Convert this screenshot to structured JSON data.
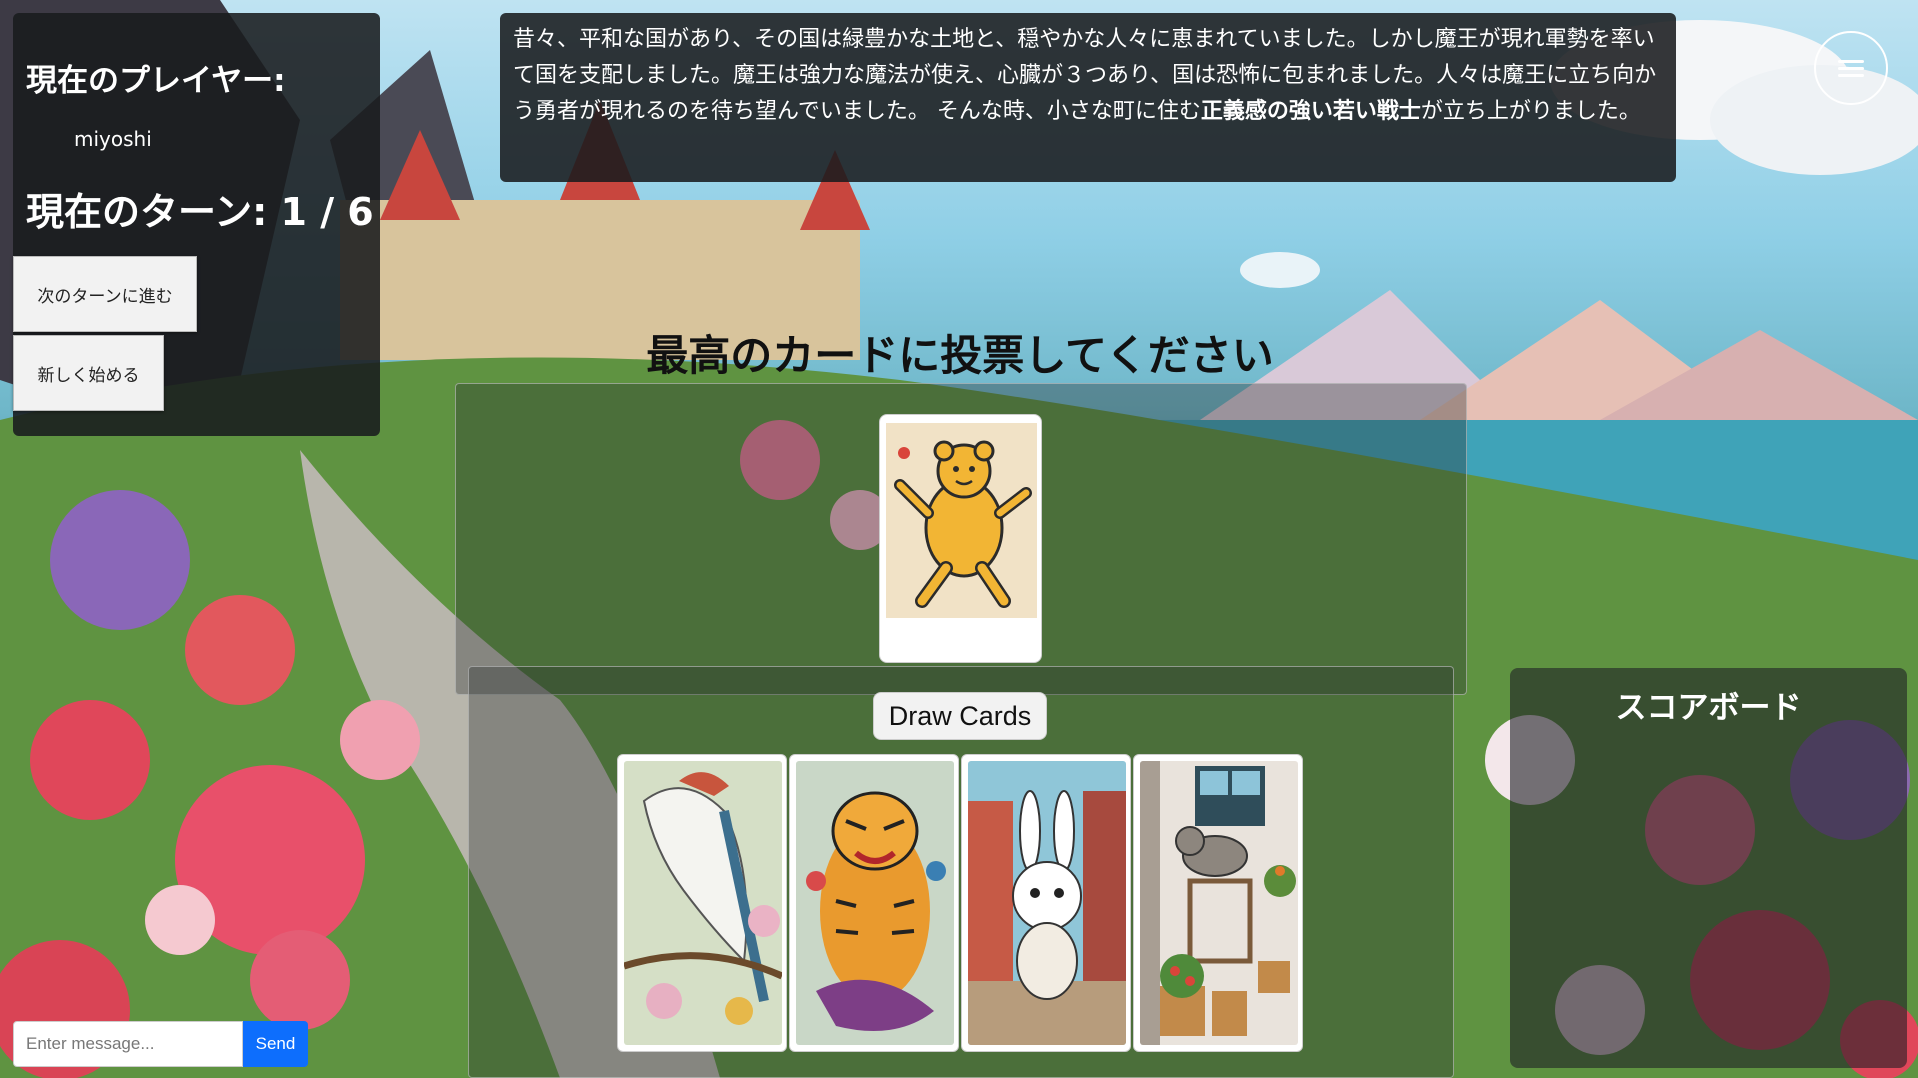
{
  "player_panel": {
    "heading": "現在のプレイヤー:",
    "player_name": "miyoshi",
    "turn_label": "現在のターン: 1 / 6",
    "next_turn_button": "次のターンに進む",
    "restart_button": "新しく始める"
  },
  "story": {
    "text_before": "昔々、平和な国があり、その国は緑豊かな土地と、穏やかな人々に恵まれていました。しかし魔王が現れ軍勢を率いて国を支配しました。魔王は強力な魔法が使え、心臓が３つあり、国は恐怖に包まれました。人々は魔王に立ち向かう勇者が現れるのを待ち望んでいました。 そんな時、小さな町に住む",
    "text_bold": "正義感の強い若い戦士",
    "text_after": "が立ち上がりました。"
  },
  "vote": {
    "title": "最高のカードに投票してください",
    "voted_card_icon": "yellow-bear-illustration"
  },
  "hand": {
    "draw_button": "Draw Cards",
    "cards": [
      {
        "icon": "bird-illustration"
      },
      {
        "icon": "tiger-illustration"
      },
      {
        "icon": "rabbit-illustration"
      },
      {
        "icon": "cat-illustration"
      }
    ]
  },
  "scoreboard": {
    "title": "スコアボード"
  },
  "chat": {
    "placeholder": "Enter message...",
    "send_label": "Send"
  },
  "colors": {
    "send_button": "#0d6efd",
    "panel": "#1e2024"
  }
}
